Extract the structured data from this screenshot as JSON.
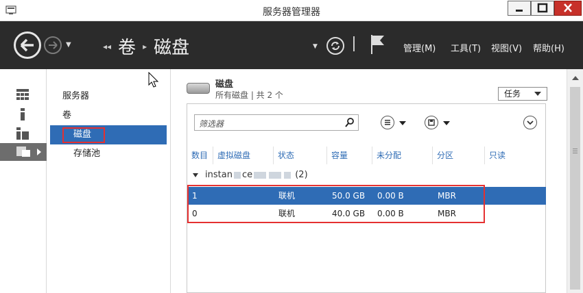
{
  "window": {
    "title": "服务器管理器",
    "accent": "#2f6cb5",
    "header_bg": "#2b2b2b",
    "close_color": "#c7312a"
  },
  "toolbar": {
    "breadcrumb": [
      "卷",
      "磁盘"
    ],
    "menu": [
      "管理(M)",
      "工具(T)",
      "视图(V)",
      "帮助(H)"
    ]
  },
  "rail": {
    "items": [
      {
        "icon": "dashboard-icon"
      },
      {
        "icon": "local-server-icon"
      },
      {
        "icon": "all-servers-icon"
      },
      {
        "icon": "file-storage-icon",
        "active": true
      }
    ]
  },
  "nav": {
    "items": [
      "服务器",
      "卷",
      "磁盘",
      "存储池"
    ],
    "selected": "磁盘"
  },
  "section": {
    "title": "磁盘",
    "subtitle": "所有磁盘 | 共 2 个",
    "tasks_label": "任务"
  },
  "filter": {
    "placeholder": "筛选器"
  },
  "table": {
    "columns": [
      "数目",
      "虚拟磁盘",
      "状态",
      "容量",
      "未分配",
      "分区",
      "只读"
    ],
    "group_label": "instan",
    "group_label_mid": "ce",
    "group_count": "(2)",
    "rows": [
      {
        "number": "1",
        "virtual_disk": "",
        "status": "联机",
        "capacity": "50.0 GB",
        "unallocated": "0.00 B",
        "partition": "MBR",
        "readonly": "",
        "selected": true
      },
      {
        "number": "0",
        "virtual_disk": "",
        "status": "联机",
        "capacity": "40.0 GB",
        "unallocated": "0.00 B",
        "partition": "MBR",
        "readonly": "",
        "selected": false
      }
    ]
  }
}
